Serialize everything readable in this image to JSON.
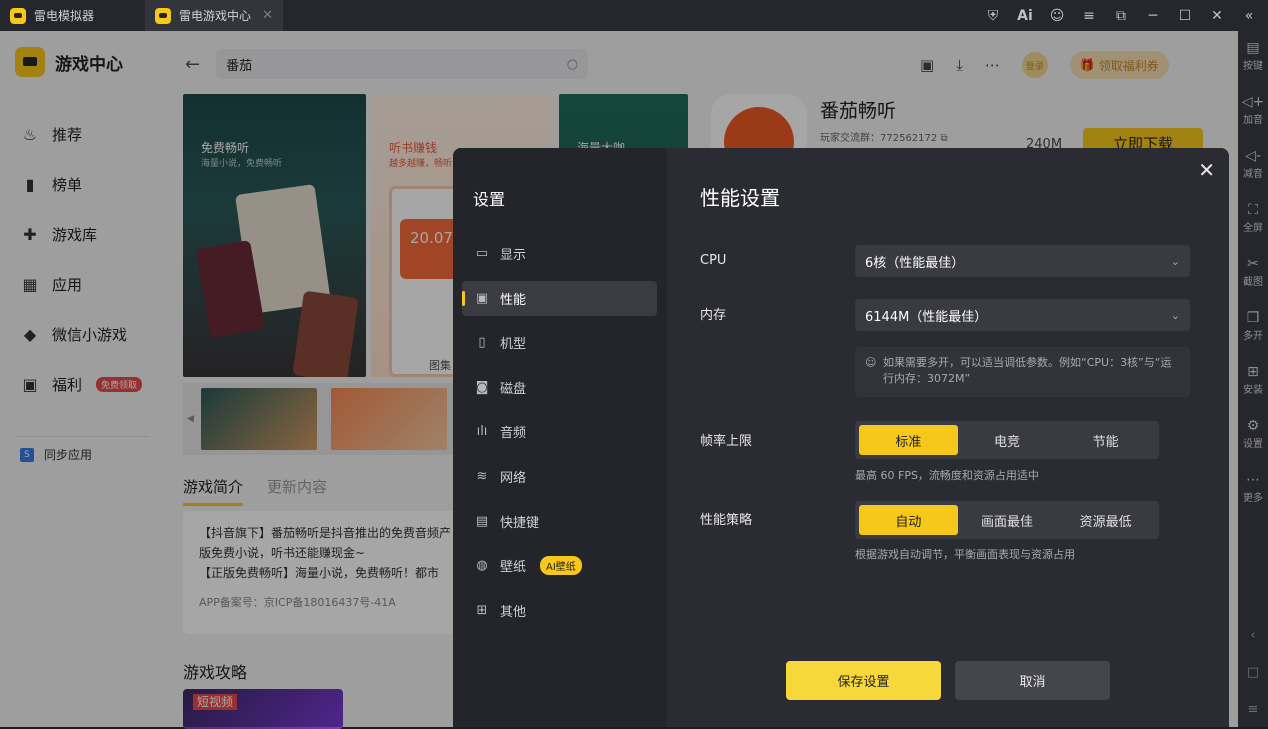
{
  "tabs": [
    {
      "label": "雷电模拟器"
    },
    {
      "label": "雷电游戏中心",
      "close": "✕"
    }
  ],
  "rightbar": [
    {
      "label": "按键",
      "icon": "keyboard-icon"
    },
    {
      "label": "加音",
      "icon": "volume-up-icon"
    },
    {
      "label": "减音",
      "icon": "volume-down-icon"
    },
    {
      "label": "全屏",
      "icon": "fullscreen-icon"
    },
    {
      "label": "截图",
      "icon": "scissors-icon"
    },
    {
      "label": "多开",
      "icon": "multi-window-icon"
    },
    {
      "label": "安装",
      "icon": "install-icon"
    },
    {
      "label": "设置",
      "icon": "gear-icon"
    },
    {
      "label": "更多",
      "icon": "more-icon"
    }
  ],
  "sidebar": {
    "brand": "游戏中心",
    "items": [
      {
        "label": "推荐",
        "icon": "fire-icon"
      },
      {
        "label": "榜单",
        "icon": "chart-icon"
      },
      {
        "label": "游戏库",
        "icon": "gamepad-icon"
      },
      {
        "label": "应用",
        "icon": "apps-icon"
      },
      {
        "label": "微信小游戏",
        "icon": "mini-game-icon"
      },
      {
        "label": "福利",
        "icon": "gift-icon",
        "badge": "免费领取"
      }
    ],
    "sync": "同步应用"
  },
  "search": {
    "value": "番茄"
  },
  "header": {
    "login": "登录",
    "coupon": "领取福利券"
  },
  "hero": {
    "shot1_title": "免费畅听",
    "shot1_sub": "海量小说，免费畅听",
    "shot2_title": "听书赚钱",
    "shot2_sub": "越多越赚，畅听无限",
    "shot2_amount": "20.07",
    "shot3_title": "海量大咖",
    "gallery": "图集"
  },
  "intro": {
    "tab_intro": "游戏简介",
    "tab_update": "更新内容",
    "line1": "【抖音旗下】番茄畅听是抖音推出的免费音频产",
    "line2": "版免费小说，听书还能赚现金~",
    "line3": "【正版免费畅听】海量小说，免费畅听！都市",
    "record": "APP备案号：京ICP备18016437号-41A",
    "guide": "游戏攻略",
    "guide_img": "短视频"
  },
  "app": {
    "name": "番茄畅听",
    "qq": "玩家交流群：772562172",
    "size": "240M",
    "download": "立即下载"
  },
  "dialog": {
    "title": "设置",
    "close": "✕",
    "menu": [
      {
        "label": "显示",
        "icon": "monitor-icon"
      },
      {
        "label": "性能",
        "icon": "performance-icon"
      },
      {
        "label": "机型",
        "icon": "phone-icon"
      },
      {
        "label": "磁盘",
        "icon": "disk-icon"
      },
      {
        "label": "音频",
        "icon": "audio-icon"
      },
      {
        "label": "网络",
        "icon": "wifi-icon"
      },
      {
        "label": "快捷键",
        "icon": "keyboard-icon"
      },
      {
        "label": "壁纸",
        "icon": "palette-icon",
        "badge": "AI壁纸"
      },
      {
        "label": "其他",
        "icon": "grid-icon"
      }
    ],
    "heading": "性能设置",
    "cpu_label": "CPU",
    "cpu_value": "6核（性能最佳）",
    "mem_label": "内存",
    "mem_value": "6144M（性能最佳）",
    "tip": "如果需要多开，可以适当调低参数。例如“CPU：3核”与“运行内存：3072M”",
    "fps_label": "帧率上限",
    "fps_options": [
      "标准",
      "电竞",
      "节能"
    ],
    "fps_hint": "最高 60 FPS，流畅度和资源占用适中",
    "strategy_label": "性能策略",
    "strategy_options": [
      "自动",
      "画面最佳",
      "资源最低"
    ],
    "strategy_hint": "根据游戏自动调节，平衡画面表现与资源占用",
    "save": "保存设置",
    "cancel": "取消"
  }
}
